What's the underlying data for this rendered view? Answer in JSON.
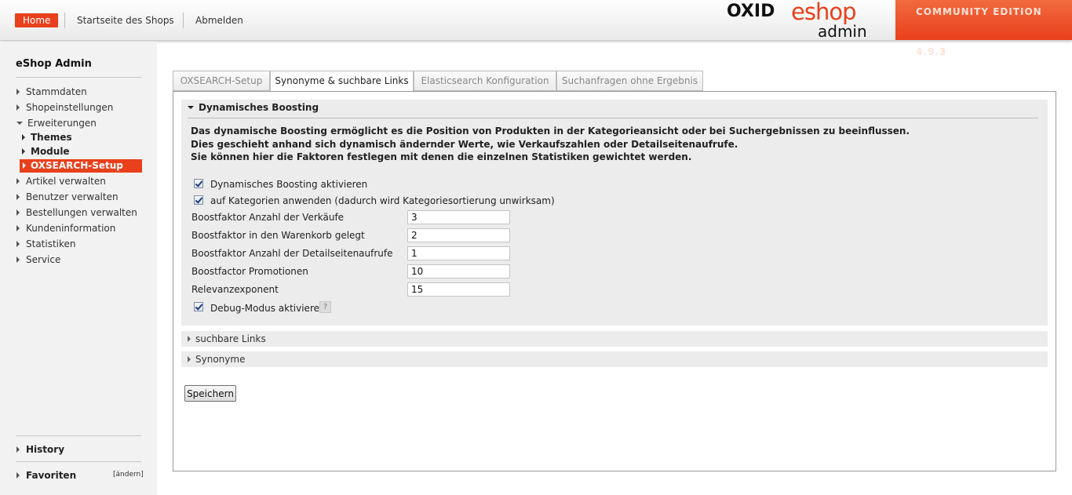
{
  "header": {
    "home": "Home",
    "shop_link": "Startseite des Shops",
    "logout": "Abmelden",
    "logo_word1": "OXID",
    "logo_word2": "eshop",
    "logo_word3": "admin",
    "edition": "COMMUNITY EDITION 4.9.3"
  },
  "sidebar": {
    "title": "eShop Admin",
    "items": [
      {
        "label": "Stammdaten"
      },
      {
        "label": "Shopeinstellungen"
      },
      {
        "label": "Erweiterungen"
      },
      {
        "label": "Themes"
      },
      {
        "label": "Module"
      },
      {
        "label": "OXSEARCH-Setup"
      },
      {
        "label": "Artikel verwalten"
      },
      {
        "label": "Benutzer verwalten"
      },
      {
        "label": "Bestellungen verwalten"
      },
      {
        "label": "Kundeninformation"
      },
      {
        "label": "Statistiken"
      },
      {
        "label": "Service"
      }
    ],
    "history": "History",
    "favoriten": "Favoriten",
    "aendern": "[ändern]"
  },
  "tabs": [
    {
      "label": "OXSEARCH-Setup"
    },
    {
      "label": "Synonyme & suchbare Links"
    },
    {
      "label": "Elasticsearch Konfiguration"
    },
    {
      "label": "Suchanfragen ohne Ergebnis"
    }
  ],
  "boosting": {
    "title": "Dynamisches Boosting",
    "desc": [
      "Das dynamische Boosting ermöglicht es die Position von Produkten in der Kategorieansicht oder bei Suchergebnissen zu beeinflussen.",
      "Dies geschieht anhand sich dynamisch ändernder Werte, wie Verkaufszahlen oder Detailseitenaufrufe.",
      "Sie können hier die Faktoren festlegen mit denen die einzelnen Statistiken gewichtet werden."
    ],
    "cb_active": "Dynamisches Boosting aktivieren",
    "cb_categories": "auf Kategorien anwenden (dadurch wird Kategoriesortierung unwirksam)",
    "fields": [
      {
        "label": "Boostfaktor Anzahl der Verkäufe",
        "value": "3"
      },
      {
        "label": "Boostfaktor in den Warenkorb gelegt",
        "value": "2"
      },
      {
        "label": "Boostfaktor Anzahl der Detailseitenaufrufe",
        "value": "1"
      },
      {
        "label": "Boostfactor Promotionen",
        "value": "10"
      },
      {
        "label": "Relevanzexponent",
        "value": "15"
      }
    ],
    "cb_debug": "Debug-Modus aktivieren",
    "help": "?"
  },
  "sections": {
    "links": "suchbare Links",
    "synonyme": "Synonyme"
  },
  "save_label": "Speichern"
}
